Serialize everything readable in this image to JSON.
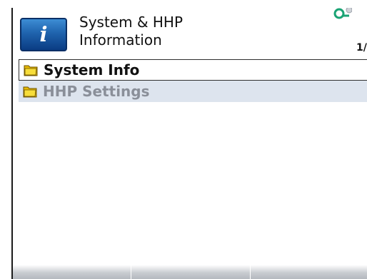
{
  "header": {
    "title_line1": "System & HHP",
    "title_line2": "Information",
    "page_indicator": "1/",
    "badge_letter": "i"
  },
  "menu": {
    "items": [
      {
        "label": "System Info",
        "icon": "folder-icon",
        "state": "selected"
      },
      {
        "label": "HHP Settings",
        "icon": "folder-icon",
        "state": "unselected"
      }
    ]
  },
  "softkeys": [
    {
      "label": ""
    },
    {
      "label": ""
    },
    {
      "label": ""
    }
  ],
  "colors": {
    "accent": "#0e78a8",
    "badge": "#1f63ad",
    "folder": "#f3d21a",
    "unselected_row": "#dde4ee",
    "unselected_text": "#8a8f99"
  }
}
